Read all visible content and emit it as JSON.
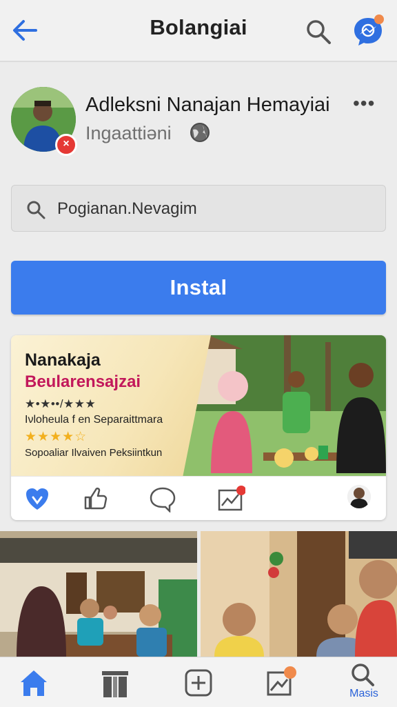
{
  "header": {
    "title": "Bolangiai",
    "back_icon": "back-arrow-icon",
    "search_icon": "search-icon",
    "messenger_icon": "messenger-icon"
  },
  "profile": {
    "name": "Adleksni Nanajan Hemayiai",
    "subtitle": "Ingaattiəni",
    "more": "•••",
    "badge": "×"
  },
  "search": {
    "placeholder": "Pogianan.Nevagim"
  },
  "install_button": {
    "label": "Instal"
  },
  "ad_card": {
    "title": "Nanakaja",
    "subtitle": "Beularensajzai",
    "rating_text": "★•★••/★★★",
    "description": "Iνloheula f en Separaittmara",
    "stars": "★★★★☆",
    "footnote": "Sopoaliar Ilvaiven Peksiintkun"
  },
  "bottom_nav": {
    "items": [
      "home-icon",
      "library-icon",
      "add-icon",
      "notifications-icon",
      "search-icon"
    ],
    "active_label": "Masis"
  },
  "colors": {
    "accent": "#3b7ced",
    "ad_subtitle": "#c2185b",
    "star": "#f2b01e",
    "badge": "#e53935"
  }
}
